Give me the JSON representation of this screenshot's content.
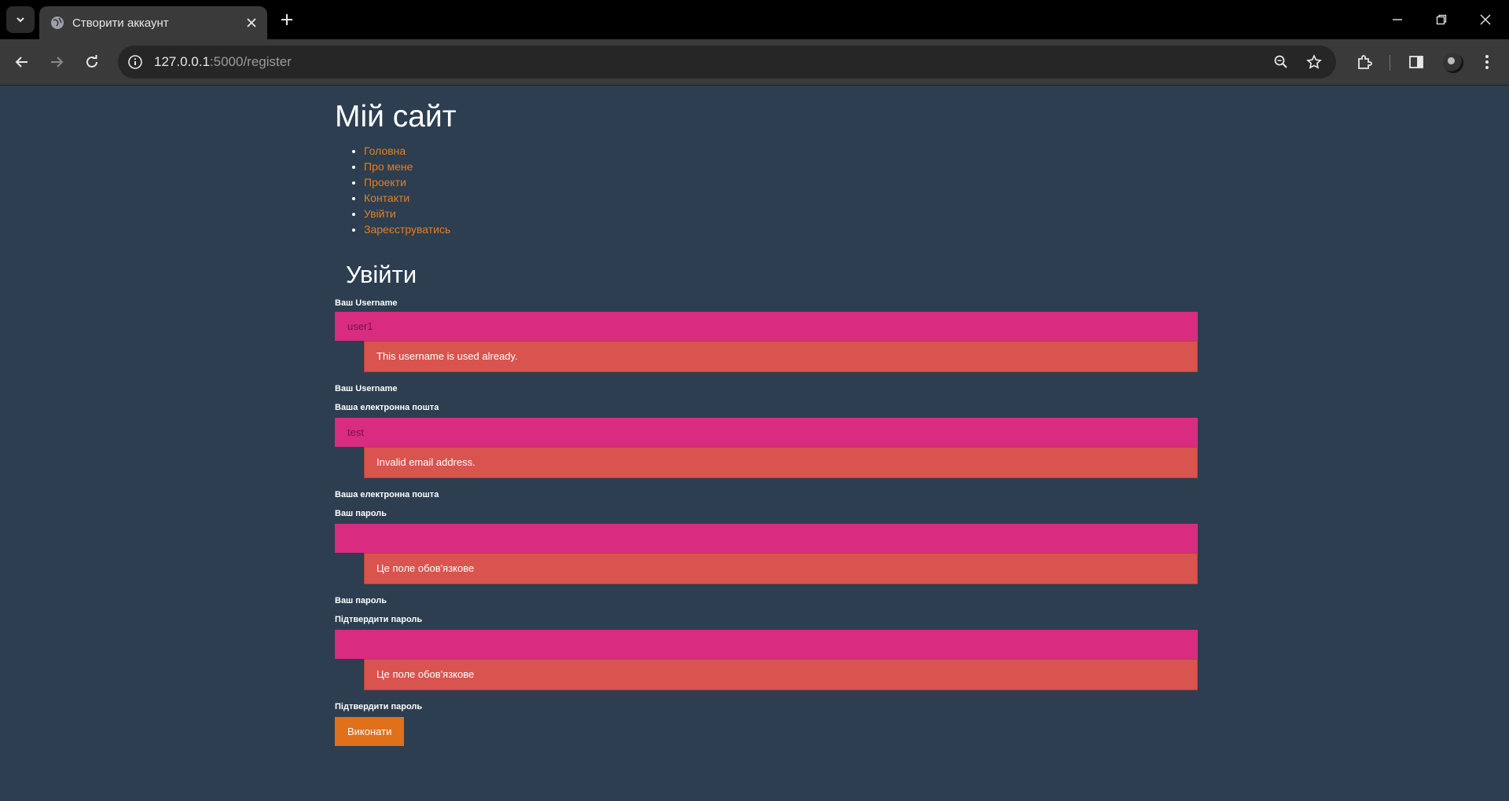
{
  "browser": {
    "tab_title": "Створити аккаунт",
    "url_host": "127.0.0.1",
    "url_rest": ":5000/register"
  },
  "site": {
    "title": "Мій сайт",
    "menu": [
      "Головна",
      "Про мене",
      "Проекти",
      "Контакти",
      "Увійти",
      "Зареєструватись"
    ]
  },
  "form": {
    "title": "Увійти",
    "username": {
      "label": "Ваш Username",
      "value": "user1",
      "error": "This username is used already.",
      "label_below": "Ваш Username"
    },
    "email": {
      "label": "Ваша електронна пошта",
      "value": "test",
      "error": "Invalid email address.",
      "label_below": "Ваша електронна пошта"
    },
    "password": {
      "label": "Ваш пароль",
      "value": "",
      "error": "Це поле обов'язкове",
      "label_below": "Ваш пароль"
    },
    "confirm": {
      "label": "Підтвердити пароль",
      "value": "",
      "error": "Це поле обов'язкове",
      "label_below": "Підтвердити пароль"
    },
    "submit_label": "Виконати"
  },
  "colors": {
    "page_bg": "#2c3e50",
    "link": "#e67e22",
    "input_bg": "#d92b80",
    "error_bg": "#d9534f",
    "button_bg": "#e0701a"
  }
}
